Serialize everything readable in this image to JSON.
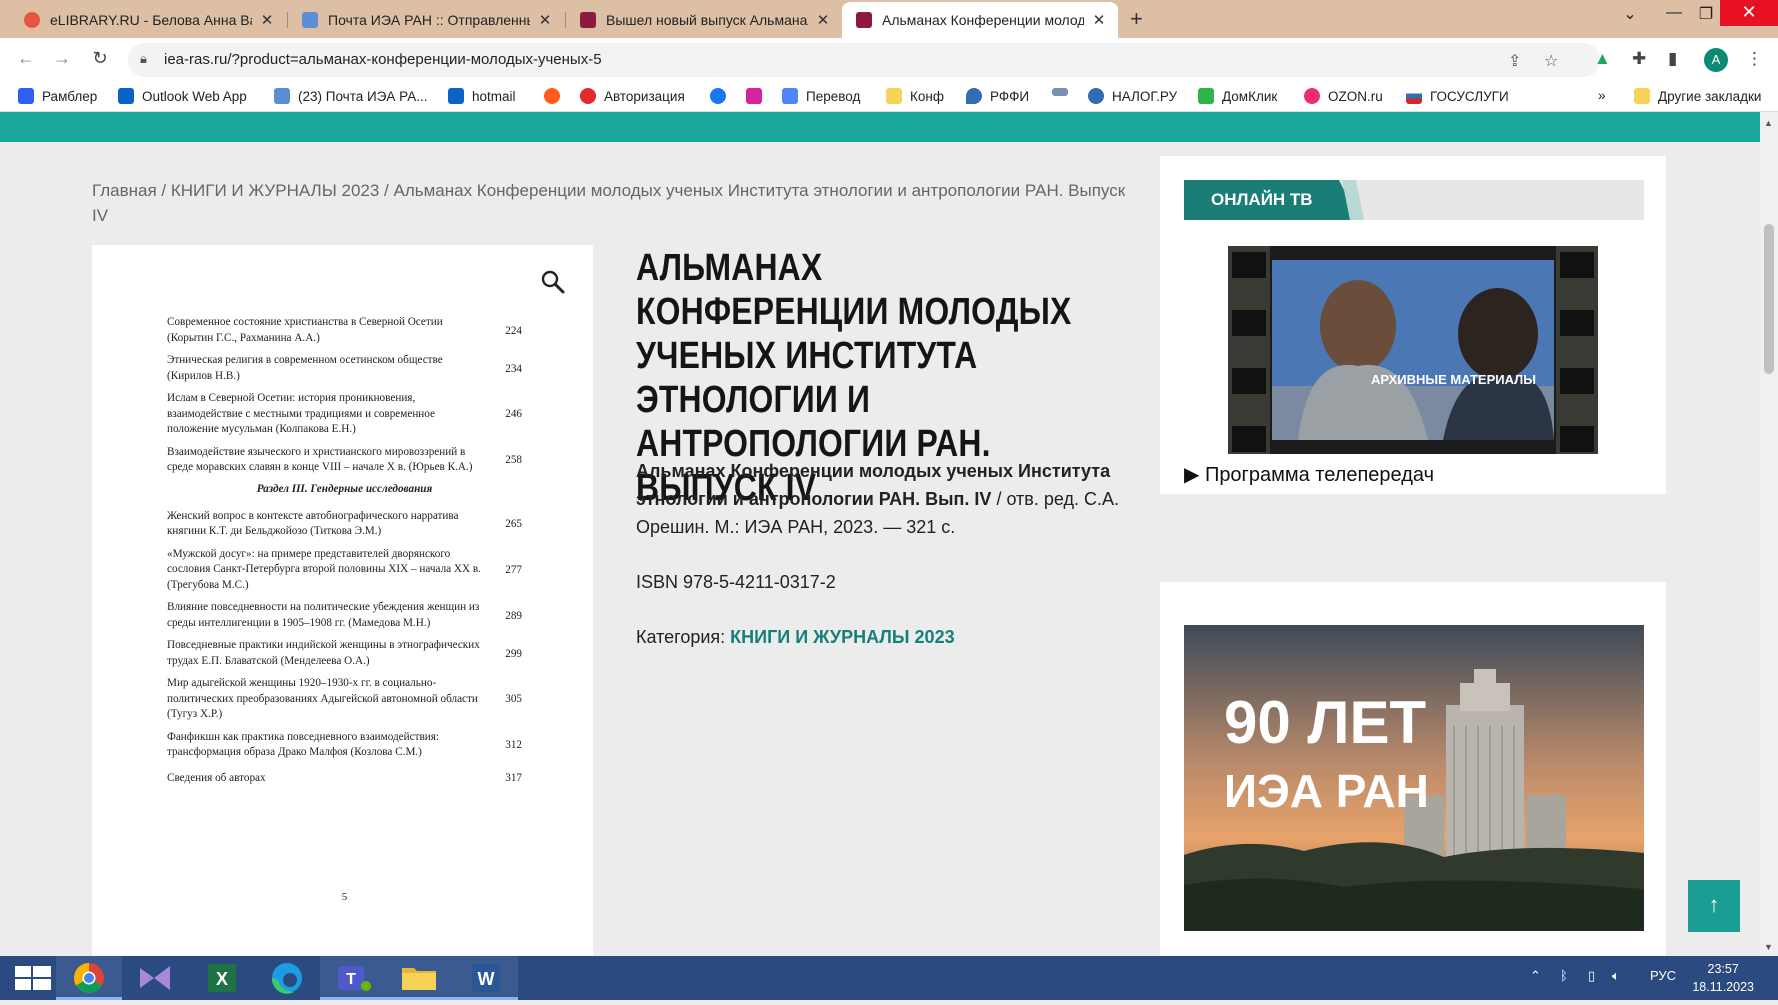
{
  "browser": {
    "tabs": [
      {
        "title": "eLIBRARY.RU - Белова Анна Вал",
        "favicon_color": "#e8553e"
      },
      {
        "title": "Почта ИЭА РАН :: Отправленны",
        "favicon_color": "#5b8ed6"
      },
      {
        "title": "Вышел новый выпуск Альманах",
        "favicon_color": "#8a1b3d"
      },
      {
        "title": "Альманах Конференции молод",
        "favicon_color": "#8a1b3d"
      }
    ],
    "new_tab_glyph": "+",
    "url": "iea-ras.ru/?product=альманах-конференции-молодых-ученых-5",
    "profile_initial": "A"
  },
  "bookmarks": [
    {
      "label": "Рамблер",
      "color": "#315efb"
    },
    {
      "label": "Outlook Web App",
      "color": "#0a64c8"
    },
    {
      "label": "(23) Почта ИЭА РА...",
      "color": "#5b8ed6"
    },
    {
      "label": "hotmail",
      "color": "#0a64c8"
    },
    {
      "label": "",
      "color": "#ff5a1f"
    },
    {
      "label": "Авторизация",
      "color": "#e32b2b"
    },
    {
      "label": "",
      "color": "#1877f2"
    },
    {
      "label": "",
      "color": "#d6249f"
    },
    {
      "label": "Перевод",
      "color": "#4f86f7"
    },
    {
      "label": "Конф",
      "color": "#f6d357"
    },
    {
      "label": "РФФИ",
      "color": "#2f6db5"
    },
    {
      "label": "",
      "color": "#7b8fb0"
    },
    {
      "label": "НАЛОГ.РУ",
      "color": "#2f6db5"
    },
    {
      "label": "ДомКлик",
      "color": "#2cb34a"
    },
    {
      "label": "OZON.ru",
      "color": "#ec2f6b"
    },
    {
      "label": "ГОСУСЛУГИ",
      "color": "#d5262d"
    }
  ],
  "bookmarks_more": "»",
  "other_bookmarks": "Другие закладки",
  "page": {
    "breadcrumb": "Главная / КНИГИ И ЖУРНАЛЫ 2023 / Альманах Конференции молодых ученых Института этнологии и антропологии РАН. Выпуск IV",
    "scan": {
      "toc": [
        {
          "t": "Современное состояние христианства в Северной Осетии (Корытин Г.С., Рахманина А.А.)",
          "p": "224"
        },
        {
          "t": "Этническая религия в современном осетинском обществе (Кирилов Н.В.)",
          "p": "234"
        },
        {
          "t": "Ислам в Северной Осетии: история проникновения, взаимодействие с местными традициями и современное положение мусульман (Колпакова Е.Н.)",
          "p": "246"
        },
        {
          "t": "Взаимодействие языческого и христианского мировоззрений в среде моравских славян в конце VIII – начале X в. (Юрьев К.А.)",
          "p": "258"
        }
      ],
      "section": "Раздел III. Гендерные исследования",
      "toc2": [
        {
          "t": "Женский вопрос в контексте автобиографического нарратива княгини К.Т. ди Бельджойозо (Титкова Э.М.)",
          "p": "265"
        },
        {
          "t": "«Мужской досуг»: на примере представителей дворянского сословия Санкт-Петербурга второй половины XIX – начала XX в. (Трегубова М.С.)",
          "p": "277"
        },
        {
          "t": "Влияние повседневности на политические убеждения женщин из среды интеллигенции в 1905–1908 гг. (Мамедова М.Н.)",
          "p": "289"
        },
        {
          "t": "Повседневные практики индийской женщины в этнографических трудах Е.П. Блаватской (Менделеева О.А.)",
          "p": "299"
        },
        {
          "t": "Мир адыгейской женщины 1920–1930-х гг. в социально-политических преобразованиях Адыгейской автономной области (Тугуз Х.Р.)",
          "p": "305"
        },
        {
          "t": "Фанфикшн как практика повседневного взаимодействия: трансформация образа Драко Малфоя (Козлова С.М.)",
          "p": "312"
        },
        {
          "t": "Сведения об авторах",
          "p": "317"
        }
      ],
      "page_number": "5"
    },
    "title": "АЛЬМАНАХ КОНФЕРЕНЦИИ МОЛОДЫХ УЧЕНЫХ ИНСТИТУТА ЭТНОЛОГИИ И АНТРОПОЛОГИИ РАН. ВЫПУСК IV",
    "desc_bold": "Альманах Конференции молодых ученых Института этнологии и антропологии РАН. Вып. IV",
    "desc_rest": " / отв. ред. С.А. Орешин. М.: ИЭА РАН, 2023. — 321 с.",
    "isbn": "ISBN 978-5-4211-0317-2",
    "category_label": "Категория: ",
    "category_link": "КНИГИ И ЖУРНАЛЫ 2023",
    "sidebar": {
      "tv_tab": "ОНЛАЙН ТВ",
      "tv_badge": "АРХИВНЫЕ МАТЕРИАЛЫ",
      "tv_program": "Программа телепередач",
      "banner_line1": "90 ЛЕТ",
      "banner_line2": "ИЭА РАН"
    },
    "back_to_top": "↑",
    "accent": "#1aa79c"
  },
  "taskbar": {
    "lang": "РУС",
    "time": "23:57",
    "date": "18.11.2023"
  }
}
